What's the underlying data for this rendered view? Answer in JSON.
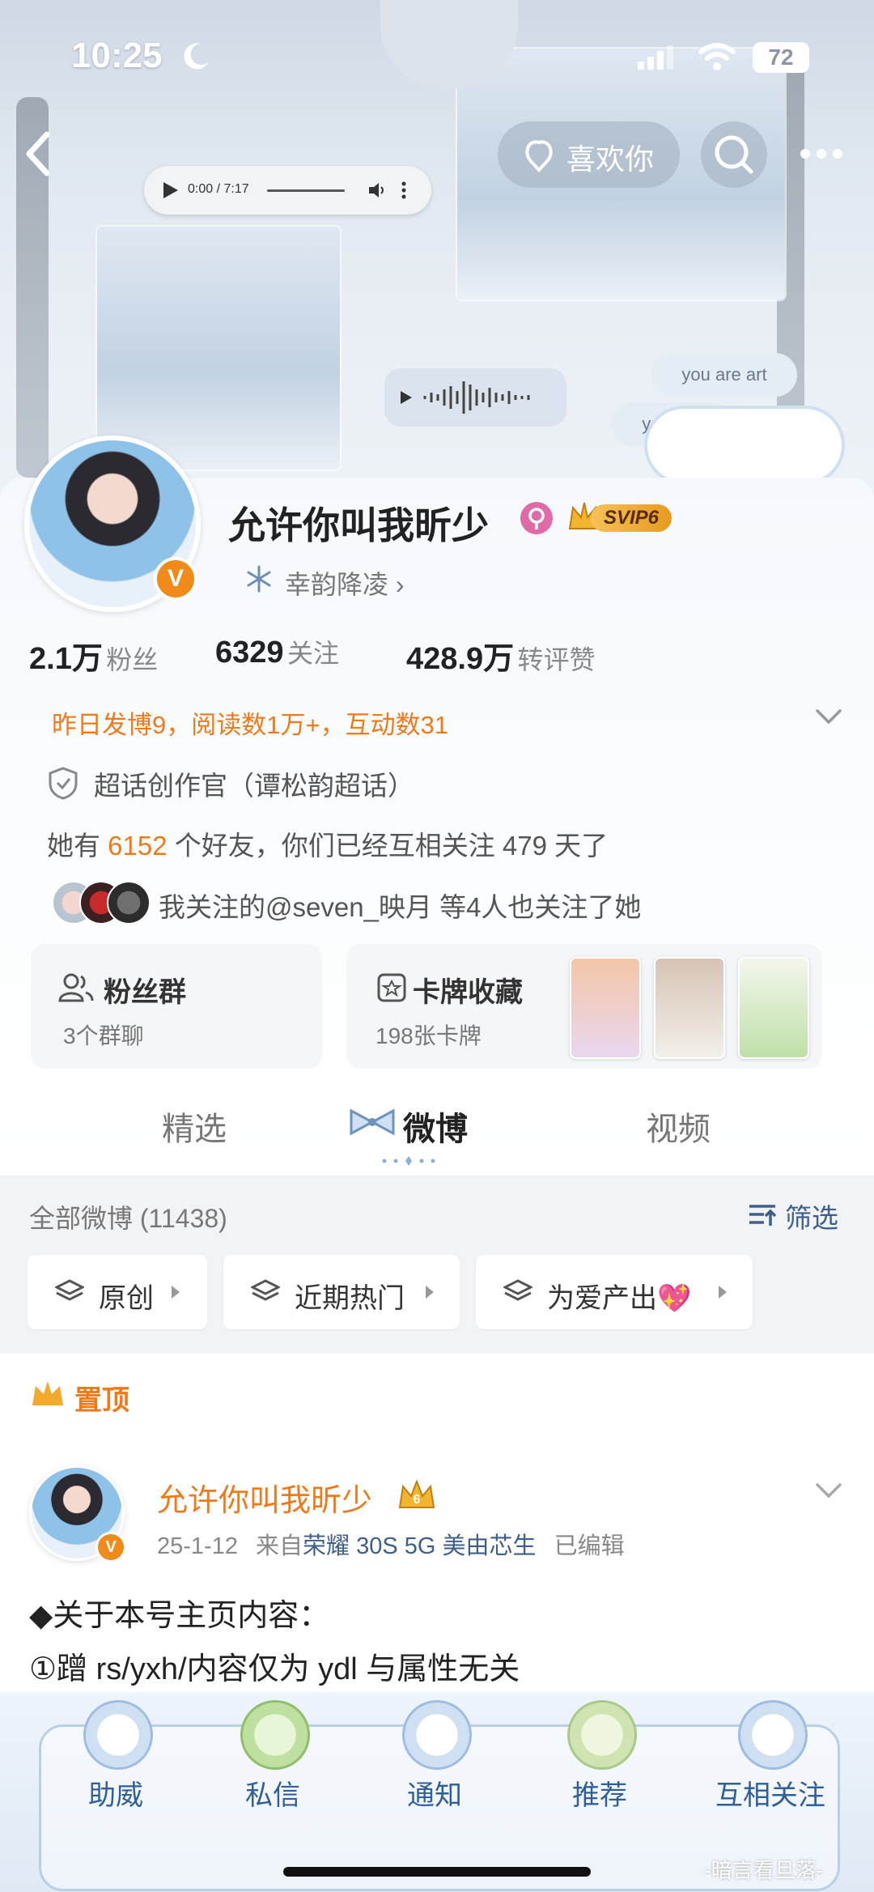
{
  "status_bar": {
    "time": "10:25",
    "battery": "72"
  },
  "header": {
    "like_label": "喜欢你"
  },
  "audio_player": {
    "time": "0:00 / 7:17"
  },
  "banner": {
    "bubble_1": "you are art",
    "bubble_2": "you are"
  },
  "profile": {
    "name": "允许你叫我昕少",
    "vip_badge": "SVIP6",
    "group_label": "幸韵降凌 ›",
    "fans_count": "2.1万",
    "fans_label": "粉丝",
    "following_count": "6329",
    "following_label": "关注",
    "likes_count": "428.9万",
    "likes_label": "转评赞",
    "activity": "昨日发博9，阅读数1万+，互动数31",
    "title_label": "超话创作官（谭松韵超话）",
    "friends_prefix": "她有 ",
    "friends_count": "6152",
    "friends_suffix": " 个好友，你们已经互相关注 479 天了",
    "mutual_follow": "我关注的@seven_映月 等4人也关注了她"
  },
  "fan_group": {
    "title": "粉丝群",
    "subtitle": "3个群聊"
  },
  "card_collection": {
    "title": "卡牌收藏",
    "subtitle": "198张卡牌"
  },
  "tabs": [
    {
      "label": "精选",
      "active": false
    },
    {
      "label": "微博",
      "active": true
    },
    {
      "label": "视频",
      "active": false
    }
  ],
  "feed": {
    "all_count": "全部微博 (11438)",
    "filter_label": "筛选",
    "chips": [
      {
        "label": "原创"
      },
      {
        "label": "近期热门"
      },
      {
        "label": "为爱产出💖"
      }
    ],
    "pinned_label": "置顶"
  },
  "post": {
    "author": "允许你叫我昕少",
    "meta_date": "25-1-12",
    "meta_from": "来自",
    "meta_device": "荣耀 30S 5G 美由芯生",
    "meta_edited": "已编辑",
    "line_1": "◆关于本号主页内容：",
    "line_2": "①蹭 rs/yxh/内容仅为 ydl 与属性无关"
  },
  "bottom_tabs": [
    {
      "label": "助威"
    },
    {
      "label": "私信"
    },
    {
      "label": "通知"
    },
    {
      "label": "推荐"
    },
    {
      "label": "互相关注"
    }
  ],
  "watermark": "-暗言看旦落-",
  "colors": {
    "accent_orange": "#f07a1a",
    "weibo_blue": "#2f5f9a",
    "vip_gold": "#e89a1e"
  }
}
